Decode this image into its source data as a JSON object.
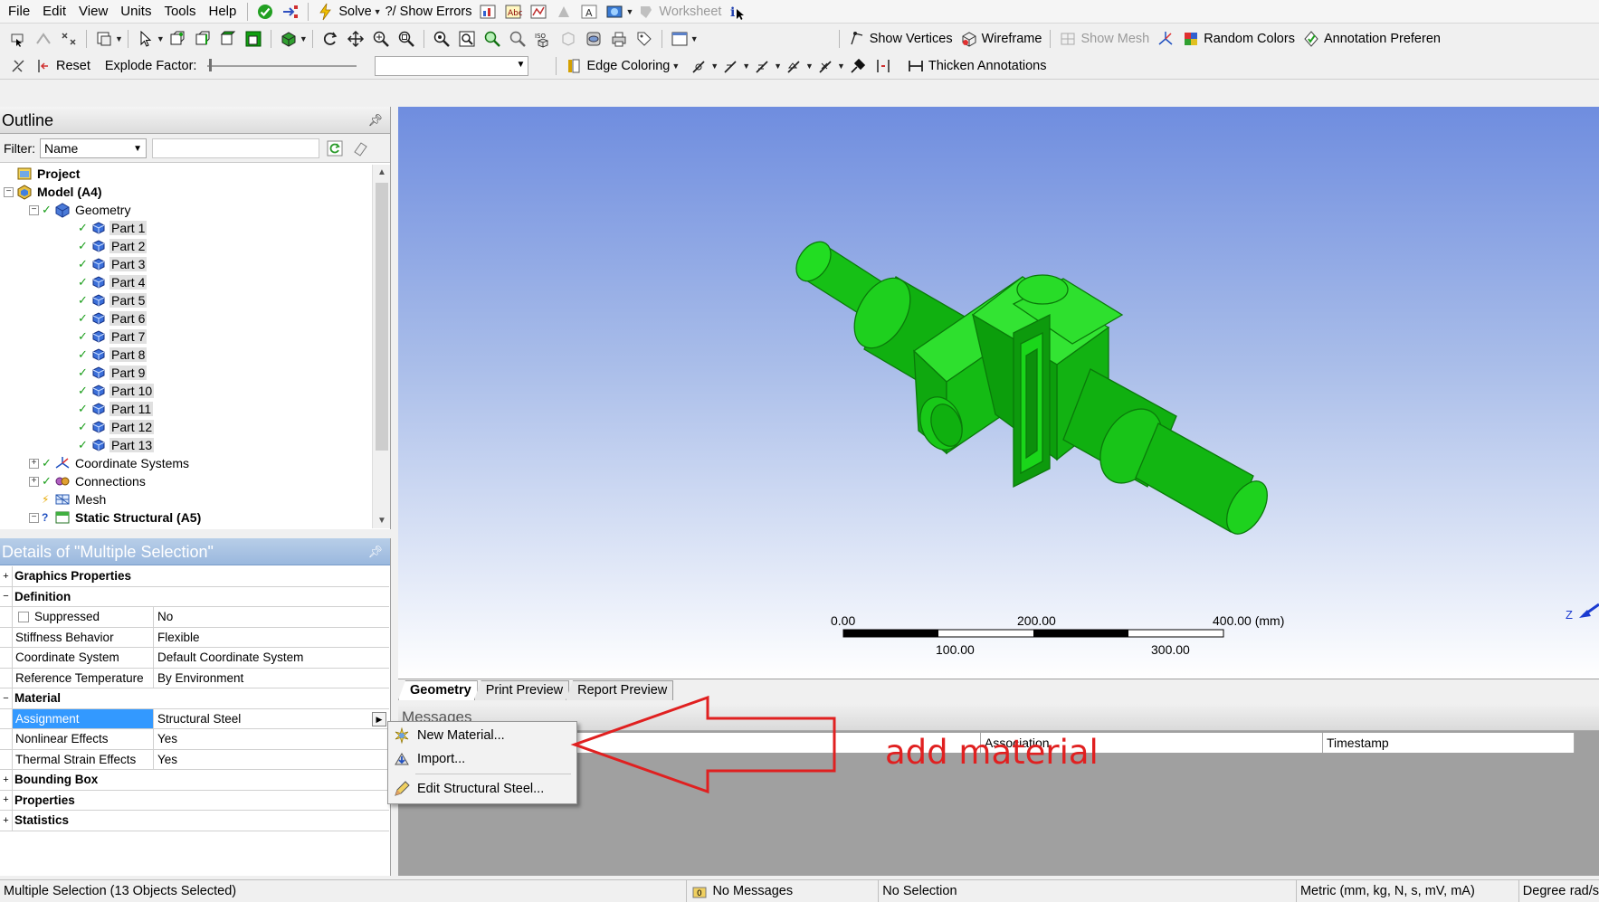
{
  "menu": [
    "File",
    "Edit",
    "View",
    "Units",
    "Tools",
    "Help"
  ],
  "toolbar1": {
    "solve": "Solve",
    "show_errors": "?/ Show Errors",
    "worksheet": "Worksheet"
  },
  "toolbar_view": {
    "show_vertices": "Show Vertices",
    "wireframe": "Wireframe",
    "show_mesh": "Show Mesh",
    "random_colors": "Random Colors",
    "annotation_preferences": "Annotation Preferen"
  },
  "toolbar2": {
    "reset": "Reset",
    "explode_factor": "Explode Factor:",
    "edge_coloring": "Edge Coloring",
    "thicken_annotations": "Thicken Annotations"
  },
  "outline": {
    "title": "Outline",
    "filter_label": "Filter:",
    "filter_value": "Name",
    "tree": {
      "project": "Project",
      "model": "Model (A4)",
      "geometry": "Geometry",
      "parts": [
        "Part 1",
        "Part 2",
        "Part 3",
        "Part 4",
        "Part 5",
        "Part 6",
        "Part 7",
        "Part 8",
        "Part 9",
        "Part 10",
        "Part 11",
        "Part 12",
        "Part 13"
      ],
      "coordinate_systems": "Coordinate Systems",
      "connections": "Connections",
      "mesh": "Mesh",
      "static_structural": "Static Structural (A5)"
    }
  },
  "details": {
    "title": "Details of \"Multiple Selection\"",
    "graphics_properties": "Graphics Properties",
    "definition": "Definition",
    "suppressed_key": "Suppressed",
    "suppressed_val": "No",
    "stiffness_key": "Stiffness Behavior",
    "stiffness_val": "Flexible",
    "coord_key": "Coordinate System",
    "coord_val": "Default Coordinate System",
    "reftemp_key": "Reference Temperature",
    "reftemp_val": "By Environment",
    "material": "Material",
    "assignment_key": "Assignment",
    "assignment_val": "Structural Steel",
    "nonlinear_key": "Nonlinear Effects",
    "nonlinear_val": "Yes",
    "thermal_key": "Thermal Strain Effects",
    "thermal_val": "Yes",
    "bounding_box": "Bounding Box",
    "properties": "Properties",
    "statistics": "Statistics"
  },
  "viewport": {
    "scale_labels": [
      "0.00",
      "200.00",
      "400.00 (mm)",
      "100.00",
      "300.00"
    ],
    "axis_label": "Z",
    "model_color": "#00cc00"
  },
  "view_tabs": [
    "Geometry",
    "Print Preview",
    "Report Preview"
  ],
  "messages": {
    "title": "Messages",
    "col_association": "Association",
    "col_timestamp": "Timestamp"
  },
  "context_menu": {
    "new_material": "New Material...",
    "import": "Import...",
    "edit": "Edit Structural Steel..."
  },
  "annotation": {
    "text": "add material",
    "color": "#e02020"
  },
  "status": {
    "selection": "Multiple Selection (13 Objects Selected)",
    "messages": "No Messages",
    "no_selection": "No Selection",
    "units": "Metric (mm, kg, N, s, mV, mA)",
    "degrees": "Degrees",
    "rads": "rad/s"
  }
}
